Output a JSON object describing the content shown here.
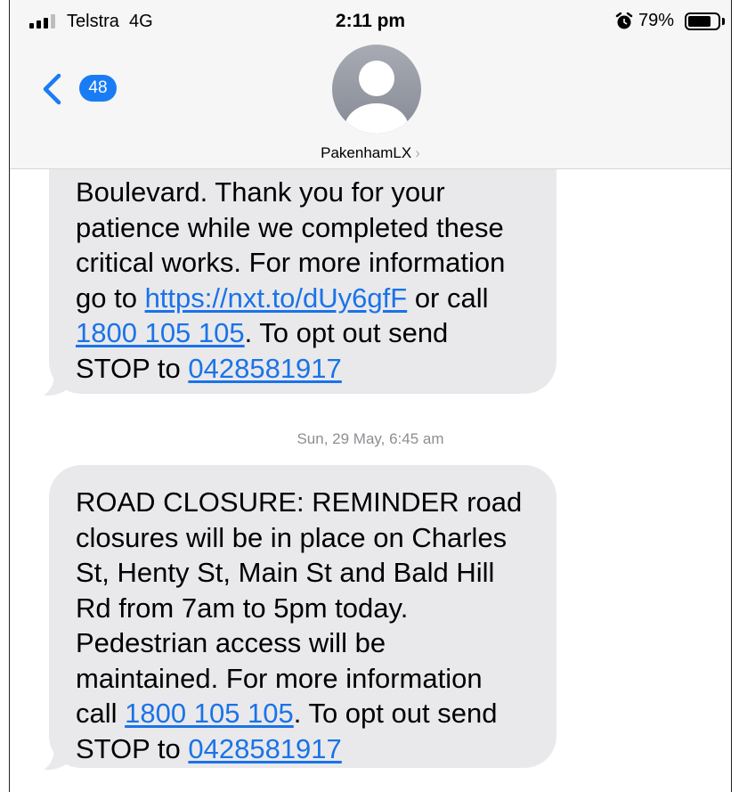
{
  "status_bar": {
    "carrier": "Telstra",
    "network": "4G",
    "time": "2:11 pm",
    "battery_percent": "79%",
    "alarm_icon": "alarm-clock-icon"
  },
  "nav": {
    "back_icon": "chevron-left-icon",
    "unread_count": "48",
    "contact_name": "PakenhamLX",
    "contact_chevron": "›",
    "avatar_icon": "person-avatar-icon"
  },
  "messages": [
    {
      "lines": [
        [
          {
            "t": "Boulevard. Thank you for your"
          }
        ],
        [
          {
            "t": "patience while we completed these"
          }
        ],
        [
          {
            "t": "critical works. For more information"
          }
        ],
        [
          {
            "t": "go to "
          },
          {
            "t": "https://nxt.to/dUy6gfF",
            "link": true
          },
          {
            "t": " or call"
          }
        ],
        [
          {
            "t": "1800 105 105",
            "link": true
          },
          {
            "t": ". To opt out send"
          }
        ],
        [
          {
            "t": "STOP to "
          },
          {
            "t": "0428581917",
            "link": true
          }
        ]
      ]
    },
    {
      "timestamp": "Sun, 29 May, 6:45 am",
      "lines": [
        [
          {
            "t": "ROAD CLOSURE: REMINDER road"
          }
        ],
        [
          {
            "t": "closures will be in place on Charles"
          }
        ],
        [
          {
            "t": "St, Henty St, Main St and Bald Hill"
          }
        ],
        [
          {
            "t": "Rd from 7am to 5pm today."
          }
        ],
        [
          {
            "t": "Pedestrian access will be"
          }
        ],
        [
          {
            "t": "maintained. For more information"
          }
        ],
        [
          {
            "t": "call "
          },
          {
            "t": "1800 105 105",
            "link": true
          },
          {
            "t": ". To opt out send"
          }
        ],
        [
          {
            "t": "STOP to "
          },
          {
            "t": "0428581917",
            "link": true
          }
        ]
      ]
    }
  ],
  "colors": {
    "bubble": "#e9e9eb",
    "link": "#1a73e8",
    "badge": "#1a7cf5",
    "timestamp": "#8e8e93"
  }
}
